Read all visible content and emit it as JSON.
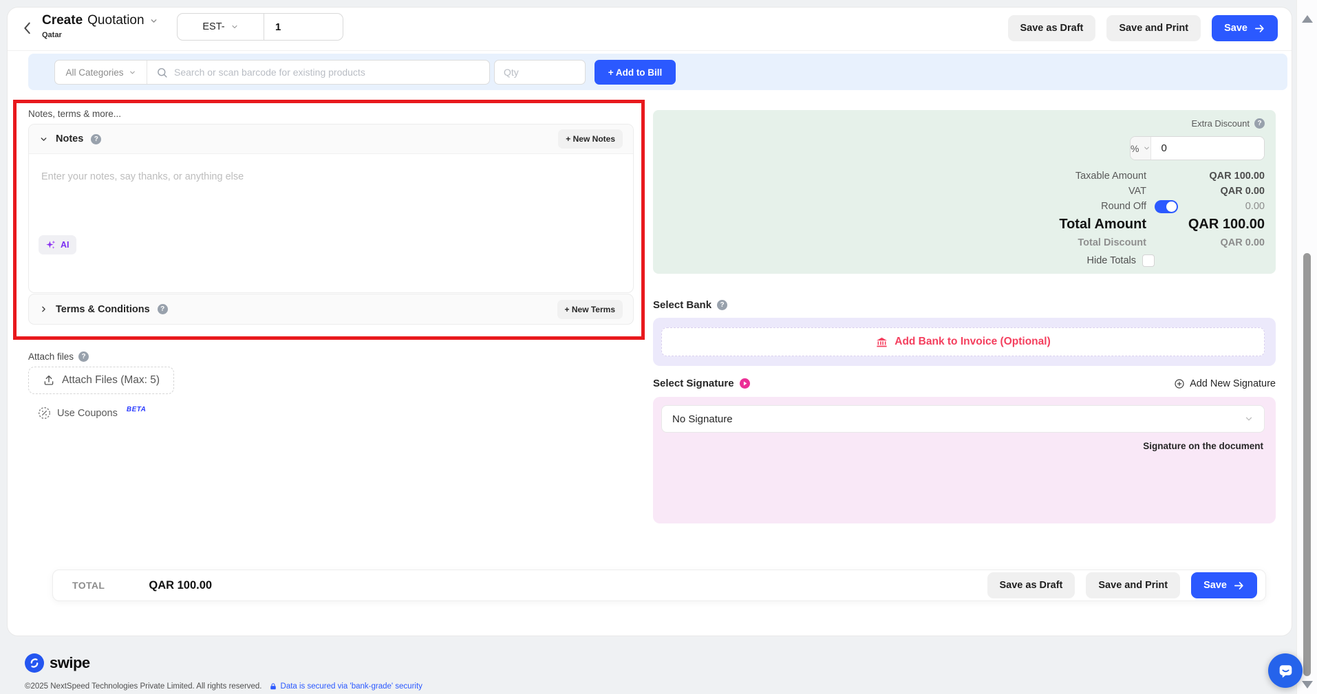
{
  "header": {
    "title_bold": "Create",
    "title_rest": "Quotation",
    "subtitle": "Qatar",
    "doc_prefix": "EST-",
    "doc_number": "1",
    "save_draft": "Save as Draft",
    "save_print": "Save and Print",
    "save": "Save"
  },
  "product_bar": {
    "category": "All Categories",
    "search_placeholder": "Search or scan barcode for existing products",
    "qty_placeholder": "Qty",
    "add_to_bill": "+ Add to Bill"
  },
  "notes": {
    "heading": "Notes, terms & more...",
    "title": "Notes",
    "new_notes": "+ New Notes",
    "placeholder": "Enter your notes, say thanks, or anything else",
    "ai": "AI",
    "terms_title": "Terms & Conditions",
    "new_terms": "+ New Terms"
  },
  "attach": {
    "label": "Attach files",
    "button": "Attach Files (Max: 5)",
    "coupons": "Use Coupons",
    "beta": "BETA"
  },
  "summary": {
    "extra_discount": "Extra Discount",
    "unit": "%",
    "discount_value": "0",
    "taxable": {
      "label": "Taxable Amount",
      "value": "QAR 100.00"
    },
    "vat": {
      "label": "VAT",
      "value": "QAR 0.00"
    },
    "round_off": {
      "label": "Round Off",
      "value": "0.00"
    },
    "total": {
      "label": "Total Amount",
      "value": "QAR 100.00"
    },
    "total_discount": {
      "label": "Total Discount",
      "value": "QAR 0.00"
    },
    "hide_totals": "Hide Totals"
  },
  "bank": {
    "label": "Select Bank",
    "button": "Add Bank to Invoice (Optional)"
  },
  "signature": {
    "label": "Select Signature",
    "add_new": "Add New Signature",
    "selected": "No Signature",
    "caption": "Signature on the document"
  },
  "total_bar": {
    "label": "TOTAL",
    "value": "QAR 100.00",
    "save_draft": "Save as Draft",
    "save_print": "Save and Print",
    "save": "Save"
  },
  "footer": {
    "brand": "swipe",
    "copyright": "©2025 NextSpeed Technologies Private Limited. All rights reserved.",
    "security": "Data is secured via 'bank-grade' security"
  },
  "icons": {
    "help": "?"
  },
  "colors": {
    "primary_blue": "#2b59ff",
    "light_blue_bar": "#e8f1fd",
    "summary_green": "#e6f1ea",
    "bank_lavender": "#ece9fb",
    "signature_pink": "#f9e8f7",
    "accent_rose": "#f43f5e",
    "badge_magenta": "#eb2f96",
    "annotation_red": "#e8191d"
  }
}
